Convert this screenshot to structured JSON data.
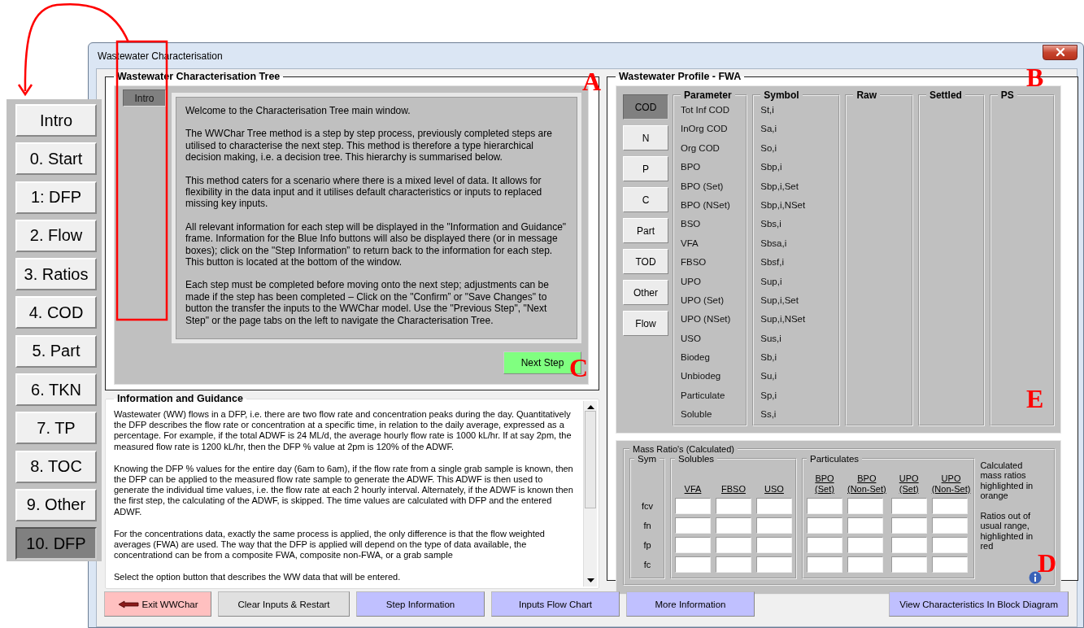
{
  "window": {
    "title": "Wastewater Characterisation"
  },
  "step_tabs": [
    {
      "label": "Intro",
      "selected": false
    },
    {
      "label": "0. Start",
      "selected": false
    },
    {
      "label": "1: DFP",
      "selected": false
    },
    {
      "label": "2. Flow",
      "selected": false
    },
    {
      "label": "3. Ratios",
      "selected": false
    },
    {
      "label": "4. COD",
      "selected": false
    },
    {
      "label": "5. Part",
      "selected": false
    },
    {
      "label": "6. TKN",
      "selected": false
    },
    {
      "label": "7. TP",
      "selected": false
    },
    {
      "label": "8. TOC",
      "selected": false
    },
    {
      "label": "9. Other",
      "selected": false
    },
    {
      "label": "10. DFP",
      "selected": true
    }
  ],
  "tree": {
    "title": "Wastewater Characterisation Tree",
    "tabs": [
      {
        "label": "Intro",
        "selected": true
      }
    ],
    "paragraphs": [
      "Welcome to the Characterisation Tree main window.",
      "The WWChar Tree method is a step by step process, previously completed steps are utilised to characterise the next step. This method is therefore a type hierarchical decision making, i.e. a decision tree. This hierarchy is summarised below.",
      "This method caters for a scenario where there is a mixed level of data. It allows for flexibility in the data input and it utilises default characteristics or inputs to replaced missing key inputs.",
      "All relevant information for each step will be displayed in the \"Information and Guidance\" frame. Information for the Blue Info buttons will also be displayed there (or in message boxes); click on the \"Step Information” to return back to the information for each step. This button is located at the bottom of the window.",
      "Each step must be completed before moving onto the next step; adjustments can be made if the step has been completed – Click on the \"Confirm” or \"Save Changes\" to button the transfer the inputs to the WWChar model. Use the \"Previous Step\", \"Next Step\" or the page tabs on the left to navigate the Characterisation Tree."
    ],
    "next_button": "Next Step"
  },
  "info": {
    "title": "Information and Guidance",
    "paragraphs": [
      "Wastewater (WW) flows in a DFP, i.e. there are two flow rate and concentration peaks during the day. Quantitatively the DFP describes the flow rate or concentration at a specific time, in relation to the daily average, expressed as a percentage. For example, if the total ADWF is 24 ML/d, the average hourly flow rate is 1000 kL/hr. If at say 2pm, the measured flow rate is 1200 kL/hr, then the DFP % value at 2pm is 120% of the ADWF.",
      "Knowing the DFP % values for the entire day (6am to 6am), if the flow rate from a single grab sample is known, then the DFP can be applied to the measured flow rate sample to generate the ADWF. This ADWF is then used to generate the individual time values, i.e. the flow rate at each 2 hourly interval. Alternately, if the ADWF is known then the first step, the calculating of the ADWF, is skipped. The time values are calculated with DFP and the entered ADWF.",
      "For the concentrations data, exactly the same process is applied, the only difference is that the flow weighted averages (FWA) are used. The way that the DFP is applied will depend on the type of data available, the concentrationd can be from a composite FWA, composite non-FWA, or a grab sample",
      "Select the option button that describes the WW data that will be entered."
    ]
  },
  "profile": {
    "title": "Wastewater Profile - FWA",
    "categories": [
      {
        "label": "COD",
        "selected": true
      },
      {
        "label": "N",
        "selected": false
      },
      {
        "label": "P",
        "selected": false
      },
      {
        "label": "C",
        "selected": false
      },
      {
        "label": "Part",
        "selected": false
      },
      {
        "label": "TOD",
        "selected": false
      },
      {
        "label": "Other",
        "selected": false
      },
      {
        "label": "Flow",
        "selected": false
      }
    ],
    "columns": [
      "Parameter",
      "Symbol",
      "Raw",
      "Settled",
      "PS"
    ],
    "rows": [
      {
        "parameter": "Tot Inf COD",
        "symbol": "St,i"
      },
      {
        "parameter": "InOrg COD",
        "symbol": "Sa,i"
      },
      {
        "parameter": "Org COD",
        "symbol": "So,i"
      },
      {
        "parameter": "BPO",
        "symbol": "Sbp,i"
      },
      {
        "parameter": "BPO (Set)",
        "symbol": "Sbp,i,Set"
      },
      {
        "parameter": "BPO (NSet)",
        "symbol": "Sbp,i,NSet"
      },
      {
        "parameter": "BSO",
        "symbol": "Sbs,i"
      },
      {
        "parameter": "VFA",
        "symbol": "Sbsa,i"
      },
      {
        "parameter": "FBSO",
        "symbol": "Sbsf,i"
      },
      {
        "parameter": "UPO",
        "symbol": "Sup,i"
      },
      {
        "parameter": "UPO (Set)",
        "symbol": "Sup,i,Set"
      },
      {
        "parameter": "UPO (NSet)",
        "symbol": "Sup,i,NSet"
      },
      {
        "parameter": "USO",
        "symbol": "Sus,i"
      },
      {
        "parameter": "Biodeg",
        "symbol": "Sb,i"
      },
      {
        "parameter": "Unbiodeg",
        "symbol": "Su,i"
      },
      {
        "parameter": "Particulate",
        "symbol": "Sp,i"
      },
      {
        "parameter": "Soluble",
        "symbol": "Ss,i"
      }
    ]
  },
  "mass_ratios": {
    "title": "Mass Ratio's (Calculated)",
    "sym_title": "Sym",
    "symbols": [
      "fcv",
      "fn",
      "fp",
      "fc"
    ],
    "groups": [
      {
        "title": "Solubles",
        "columns": [
          "VFA",
          "FBSO",
          "USO"
        ]
      },
      {
        "title": "Particulates",
        "columns": [
          "BPO\n(Set)",
          "BPO\n(Non-Set)",
          "UPO\n(Set)",
          "UPO\n(Non-Set)"
        ]
      }
    ],
    "notes": [
      "Calculated mass ratios highlighted in orange",
      "Ratios out of usual range, highlighted in red"
    ]
  },
  "buttons": [
    {
      "label": "Exit WWChar",
      "kind": "exit"
    },
    {
      "label": "Clear Inputs & Restart",
      "kind": "clear"
    },
    {
      "label": "Step Information",
      "kind": "info"
    },
    {
      "label": "Inputs Flow Chart",
      "kind": "info"
    },
    {
      "label": "More Information",
      "kind": "info"
    },
    {
      "label": "View Characteristics In Block Diagram",
      "kind": "info"
    }
  ],
  "annotations": [
    "A",
    "B",
    "C",
    "E",
    "D"
  ]
}
